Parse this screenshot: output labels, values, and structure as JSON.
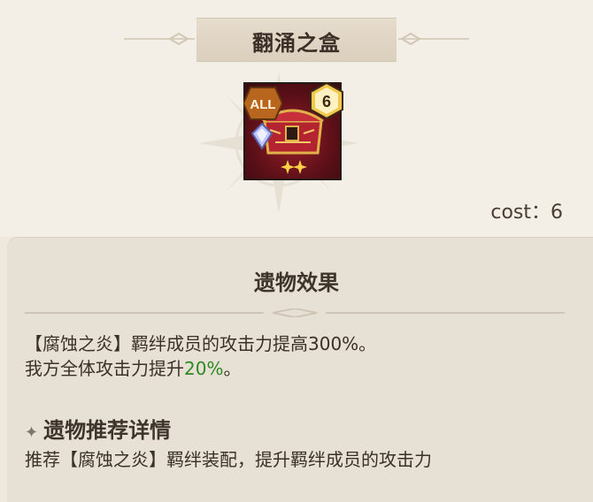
{
  "relic": {
    "name": "翻涌之盒",
    "badge_all": "ALL",
    "level": "6",
    "cost_label": "cost：6"
  },
  "effects_section": {
    "title": "遗物效果",
    "line1": "【腐蚀之炎】羁绊成员的攻击力提高300%。",
    "line2_prefix": "我方全体攻击力提升",
    "line2_value": "20%",
    "line2_suffix": "。"
  },
  "recommendation": {
    "title": "遗物推荐详情",
    "text": "推荐【腐蚀之炎】羁绊装配，提升羁绊成员的攻击力"
  },
  "colors": {
    "highlight": "#2d8a24",
    "frame_red": "#7a1220",
    "gold": "#e6b43c"
  },
  "icons": [
    "compass-rose-icon",
    "all-badge-icon",
    "level-hex-icon",
    "chest-icon",
    "crystal-icon",
    "sparkle-icon",
    "diamond-bullet-icon"
  ]
}
